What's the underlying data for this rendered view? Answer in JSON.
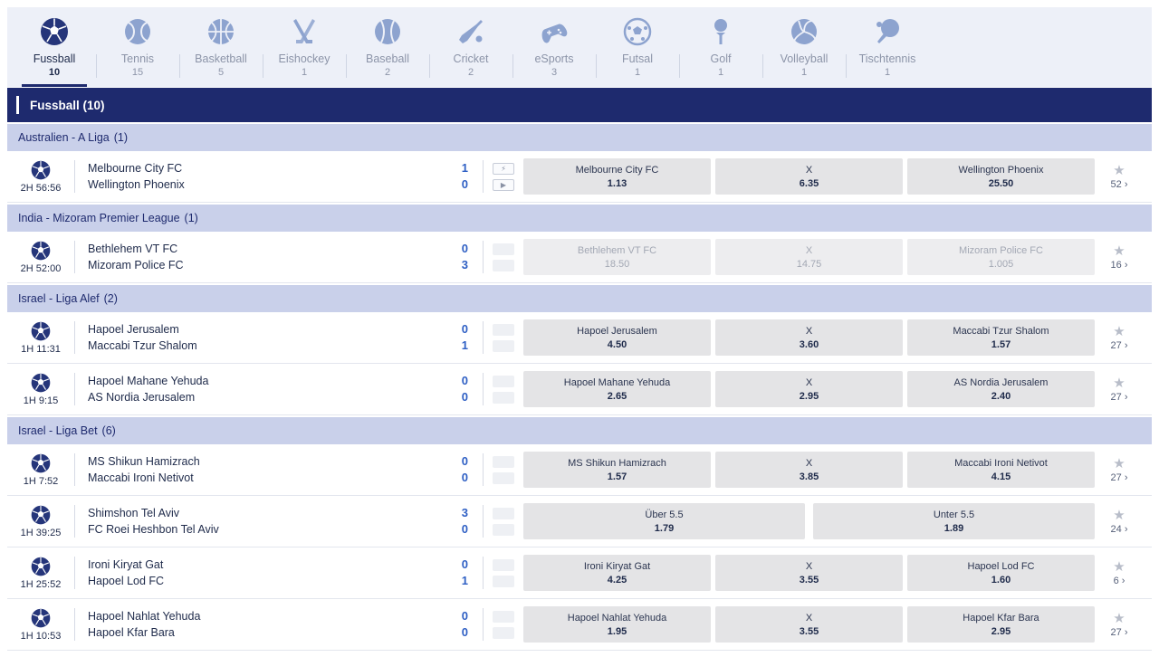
{
  "sports": [
    {
      "key": "fussball",
      "name": "Fussball",
      "count": "10",
      "active": true,
      "icon": "soccer-ball-icon"
    },
    {
      "key": "tennis",
      "name": "Tennis",
      "count": "15",
      "active": false,
      "icon": "tennis-ball-icon"
    },
    {
      "key": "basketball",
      "name": "Basketball",
      "count": "5",
      "active": false,
      "icon": "basketball-icon"
    },
    {
      "key": "eishockey",
      "name": "Eishockey",
      "count": "1",
      "active": false,
      "icon": "hockey-sticks-icon"
    },
    {
      "key": "baseball",
      "name": "Baseball",
      "count": "2",
      "active": false,
      "icon": "baseball-icon"
    },
    {
      "key": "cricket",
      "name": "Cricket",
      "count": "2",
      "active": false,
      "icon": "cricket-bat-icon"
    },
    {
      "key": "esports",
      "name": "eSports",
      "count": "3",
      "active": false,
      "icon": "gamepad-icon"
    },
    {
      "key": "futsal",
      "name": "Futsal",
      "count": "1",
      "active": false,
      "icon": "futsal-ball-icon"
    },
    {
      "key": "golf",
      "name": "Golf",
      "count": "1",
      "active": false,
      "icon": "golf-tee-icon"
    },
    {
      "key": "volleyball",
      "name": "Volleyball",
      "count": "1",
      "active": false,
      "icon": "volleyball-icon"
    },
    {
      "key": "tischtennis",
      "name": "Tischtennis",
      "count": "1",
      "active": false,
      "icon": "ping-pong-icon"
    }
  ],
  "section": {
    "title": "Fussball (10)"
  },
  "colors": {
    "primary": "#1e2a6e",
    "league_bg": "#c9d0ea",
    "score": "#2e5fc4",
    "odds_bg": "#e4e4e6"
  },
  "leagues": [
    {
      "name": "Australien - A Liga",
      "count": "(1)",
      "matches": [
        {
          "time": "2H 56:56",
          "home": "Melbourne City FC",
          "away": "Wellington Phoenix",
          "score_home": "1",
          "score_away": "0",
          "media": true,
          "suspended": false,
          "odds": [
            {
              "label": "Melbourne City FC",
              "value": "1.13"
            },
            {
              "label": "X",
              "value": "6.35"
            },
            {
              "label": "Wellington Phoenix",
              "value": "25.50"
            }
          ],
          "markets": "52"
        }
      ]
    },
    {
      "name": "India - Mizoram Premier League",
      "count": "(1)",
      "matches": [
        {
          "time": "2H 52:00",
          "home": "Bethlehem VT FC",
          "away": "Mizoram Police FC",
          "score_home": "0",
          "score_away": "3",
          "media": false,
          "suspended": true,
          "odds": [
            {
              "label": "Bethlehem VT FC",
              "value": "18.50"
            },
            {
              "label": "X",
              "value": "14.75"
            },
            {
              "label": "Mizoram Police FC",
              "value": "1.005"
            }
          ],
          "markets": "16"
        }
      ]
    },
    {
      "name": "Israel - Liga Alef",
      "count": "(2)",
      "matches": [
        {
          "time": "1H 11:31",
          "home": "Hapoel Jerusalem",
          "away": "Maccabi Tzur Shalom",
          "score_home": "0",
          "score_away": "1",
          "media": false,
          "suspended": false,
          "odds": [
            {
              "label": "Hapoel Jerusalem",
              "value": "4.50"
            },
            {
              "label": "X",
              "value": "3.60"
            },
            {
              "label": "Maccabi Tzur Shalom",
              "value": "1.57"
            }
          ],
          "markets": "27"
        },
        {
          "time": "1H 9:15",
          "home": "Hapoel Mahane Yehuda",
          "away": "AS Nordia Jerusalem",
          "score_home": "0",
          "score_away": "0",
          "media": false,
          "suspended": false,
          "odds": [
            {
              "label": "Hapoel Mahane Yehuda",
              "value": "2.65"
            },
            {
              "label": "X",
              "value": "2.95"
            },
            {
              "label": "AS Nordia Jerusalem",
              "value": "2.40"
            }
          ],
          "markets": "27"
        }
      ]
    },
    {
      "name": "Israel - Liga Bet",
      "count": "(6)",
      "matches": [
        {
          "time": "1H 7:52",
          "home": "MS Shikun Hamizrach",
          "away": "Maccabi Ironi Netivot",
          "score_home": "0",
          "score_away": "0",
          "media": false,
          "suspended": false,
          "odds": [
            {
              "label": "MS Shikun Hamizrach",
              "value": "1.57"
            },
            {
              "label": "X",
              "value": "3.85"
            },
            {
              "label": "Maccabi Ironi Netivot",
              "value": "4.15"
            }
          ],
          "markets": "27"
        },
        {
          "time": "1H 39:25",
          "home": "Shimshon Tel Aviv",
          "away": "FC Roei Heshbon Tel Aviv",
          "score_home": "3",
          "score_away": "0",
          "media": false,
          "suspended": false,
          "odds": [
            {
              "label": "Über  5.5",
              "value": "1.79"
            },
            {
              "label": "Unter  5.5",
              "value": "1.89"
            }
          ],
          "markets": "24"
        },
        {
          "time": "1H 25:52",
          "home": "Ironi Kiryat Gat",
          "away": "Hapoel Lod FC",
          "score_home": "0",
          "score_away": "1",
          "media": false,
          "suspended": false,
          "odds": [
            {
              "label": "Ironi Kiryat Gat",
              "value": "4.25"
            },
            {
              "label": "X",
              "value": "3.55"
            },
            {
              "label": "Hapoel Lod FC",
              "value": "1.60"
            }
          ],
          "markets": "6"
        },
        {
          "time": "1H 10:53",
          "home": "Hapoel Nahlat Yehuda",
          "away": "Hapoel Kfar Bara",
          "score_home": "0",
          "score_away": "0",
          "media": false,
          "suspended": false,
          "odds": [
            {
              "label": "Hapoel Nahlat Yehuda",
              "value": "1.95"
            },
            {
              "label": "X",
              "value": "3.55"
            },
            {
              "label": "Hapoel Kfar Bara",
              "value": "2.95"
            }
          ],
          "markets": "27"
        }
      ]
    }
  ]
}
